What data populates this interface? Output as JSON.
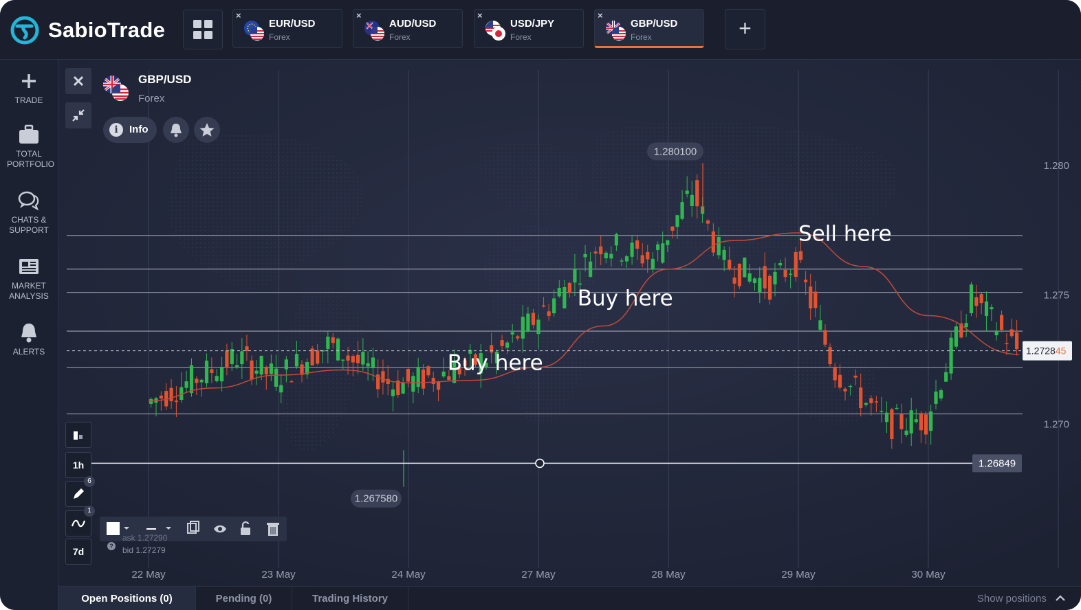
{
  "brand": {
    "name": "SabioTrade"
  },
  "tabs": [
    {
      "pair": "EUR/USD",
      "market": "Forex",
      "close": "×",
      "active": false,
      "flag": "eu-us-flag"
    },
    {
      "pair": "AUD/USD",
      "market": "Forex",
      "close": "×",
      "active": false,
      "flag": "au-us-flag"
    },
    {
      "pair": "USD/JPY",
      "market": "Forex",
      "close": "×",
      "active": false,
      "flag": "us-jp-flag"
    },
    {
      "pair": "GBP/USD",
      "market": "Forex",
      "close": "×",
      "active": true,
      "flag": "gb-us-flag"
    }
  ],
  "add_tab": "+",
  "sidebar": {
    "items": [
      {
        "label": "TRADE",
        "icon": "plus-icon"
      },
      {
        "label": "TOTAL PORTFOLIO",
        "icon": "briefcase-icon"
      },
      {
        "label": "CHATS & SUPPORT",
        "icon": "chat-icon"
      },
      {
        "label": "MARKET ANALYSIS",
        "icon": "newspaper-icon"
      },
      {
        "label": "ALERTS",
        "icon": "bell-icon"
      }
    ]
  },
  "symbol": {
    "name": "GBP/USD",
    "market": "Forex",
    "info_label": "Info"
  },
  "left_tools": {
    "timeframe": "1h",
    "draw_count": "6",
    "indicator_count": "1",
    "range": "7d"
  },
  "quote": {
    "ask": "ask 1.27290",
    "bid": "bid 1.27279"
  },
  "colors": {
    "up": "#2fb84f",
    "down": "#e4532f",
    "accent": "#e9733b",
    "ma": "#c24a3a",
    "background": "#1f2435"
  },
  "chart_data": {
    "type": "candlestick",
    "instrument": "GBP/USD",
    "x_labels": [
      "22 May",
      "23 May",
      "24 May",
      "27 May",
      "28 May",
      "29 May",
      "30 May"
    ],
    "y_ticks": [
      "1.280",
      "1.275",
      "1.270"
    ],
    "y_tick_values": [
      1.28,
      1.275,
      1.27
    ],
    "ylim": [
      1.2655,
      1.2825
    ],
    "current_price": {
      "value": 1.27284,
      "label_main": "1.2728",
      "label_tail": "45"
    },
    "high_marker": {
      "value": 1.2801,
      "label": "1.280100"
    },
    "low_marker": {
      "value": 1.26758,
      "label": "1.267580"
    },
    "horizontal_line": {
      "value": 1.26849,
      "label": "1.26849"
    },
    "levels": [
      1.2736,
      1.2751,
      1.276,
      1.2773,
      1.2722,
      1.2704
    ],
    "annotations": [
      {
        "text": "Sell here",
        "price": 1.2771,
        "day": 5.0
      },
      {
        "text": "Buy here",
        "price": 1.2746,
        "day": 3.3
      },
      {
        "text": "Buy here",
        "price": 1.2721,
        "day": 2.3
      }
    ],
    "moving_average": [
      [
        0,
        1.2709
      ],
      [
        0.5,
        1.2714
      ],
      [
        1,
        1.2719
      ],
      [
        1.5,
        1.2721
      ],
      [
        2,
        1.2716
      ],
      [
        2.5,
        1.2717
      ],
      [
        3,
        1.2722
      ],
      [
        3.5,
        1.2738
      ],
      [
        4,
        1.276
      ],
      [
        4.5,
        1.2771
      ],
      [
        5,
        1.2774
      ],
      [
        5.5,
        1.2761
      ],
      [
        6,
        1.2742
      ],
      [
        6.7,
        1.2727
      ]
    ],
    "segments": [
      [
        0,
        1.2708,
        0,
        1.2708,
        0.6
      ],
      [
        0.7,
        1.2726,
        0.3,
        1.2722,
        0.5
      ],
      [
        1,
        1.2718,
        0.6,
        1.272,
        0.8
      ],
      [
        1.4,
        1.2731,
        0.7,
        1.2726,
        0.3
      ],
      [
        1.9,
        1.2715,
        0.6,
        1.2715,
        0.6
      ],
      [
        2.25,
        1.2719,
        0.5,
        1.2726,
        0.8
      ],
      [
        2.7,
        1.2727,
        0.5,
        1.2727,
        0.6
      ],
      [
        3.1,
        1.2746,
        0.8,
        1.2746,
        0.6
      ],
      [
        3.5,
        1.277,
        0.7,
        1.2764,
        0.5
      ],
      [
        3.9,
        1.2764,
        0.6,
        1.2774,
        0.5
      ],
      [
        4.2,
        1.279,
        0.6,
        1.278,
        0.5
      ],
      [
        4.45,
        1.2762,
        0.6,
        1.2762,
        0.6
      ],
      [
        4.8,
        1.2754,
        0.6,
        1.275,
        0.4
      ],
      [
        5,
        1.2763,
        0.7,
        1.2757,
        0.5
      ],
      [
        5.3,
        1.2721,
        0.7,
        1.2708,
        0.6
      ],
      [
        5.7,
        1.27,
        0.5,
        1.269,
        0.4
      ],
      [
        6,
        1.2702,
        0.6,
        1.2726,
        0.9
      ],
      [
        6.35,
        1.2749,
        0.5,
        1.2738,
        0.5
      ],
      [
        6.7,
        1.2729,
        0.4,
        1.2729,
        0.4
      ]
    ]
  },
  "bottom": {
    "tabs": [
      "Open Positions (0)",
      "Pending (0)",
      "Trading History"
    ],
    "show_positions": "Show positions"
  }
}
